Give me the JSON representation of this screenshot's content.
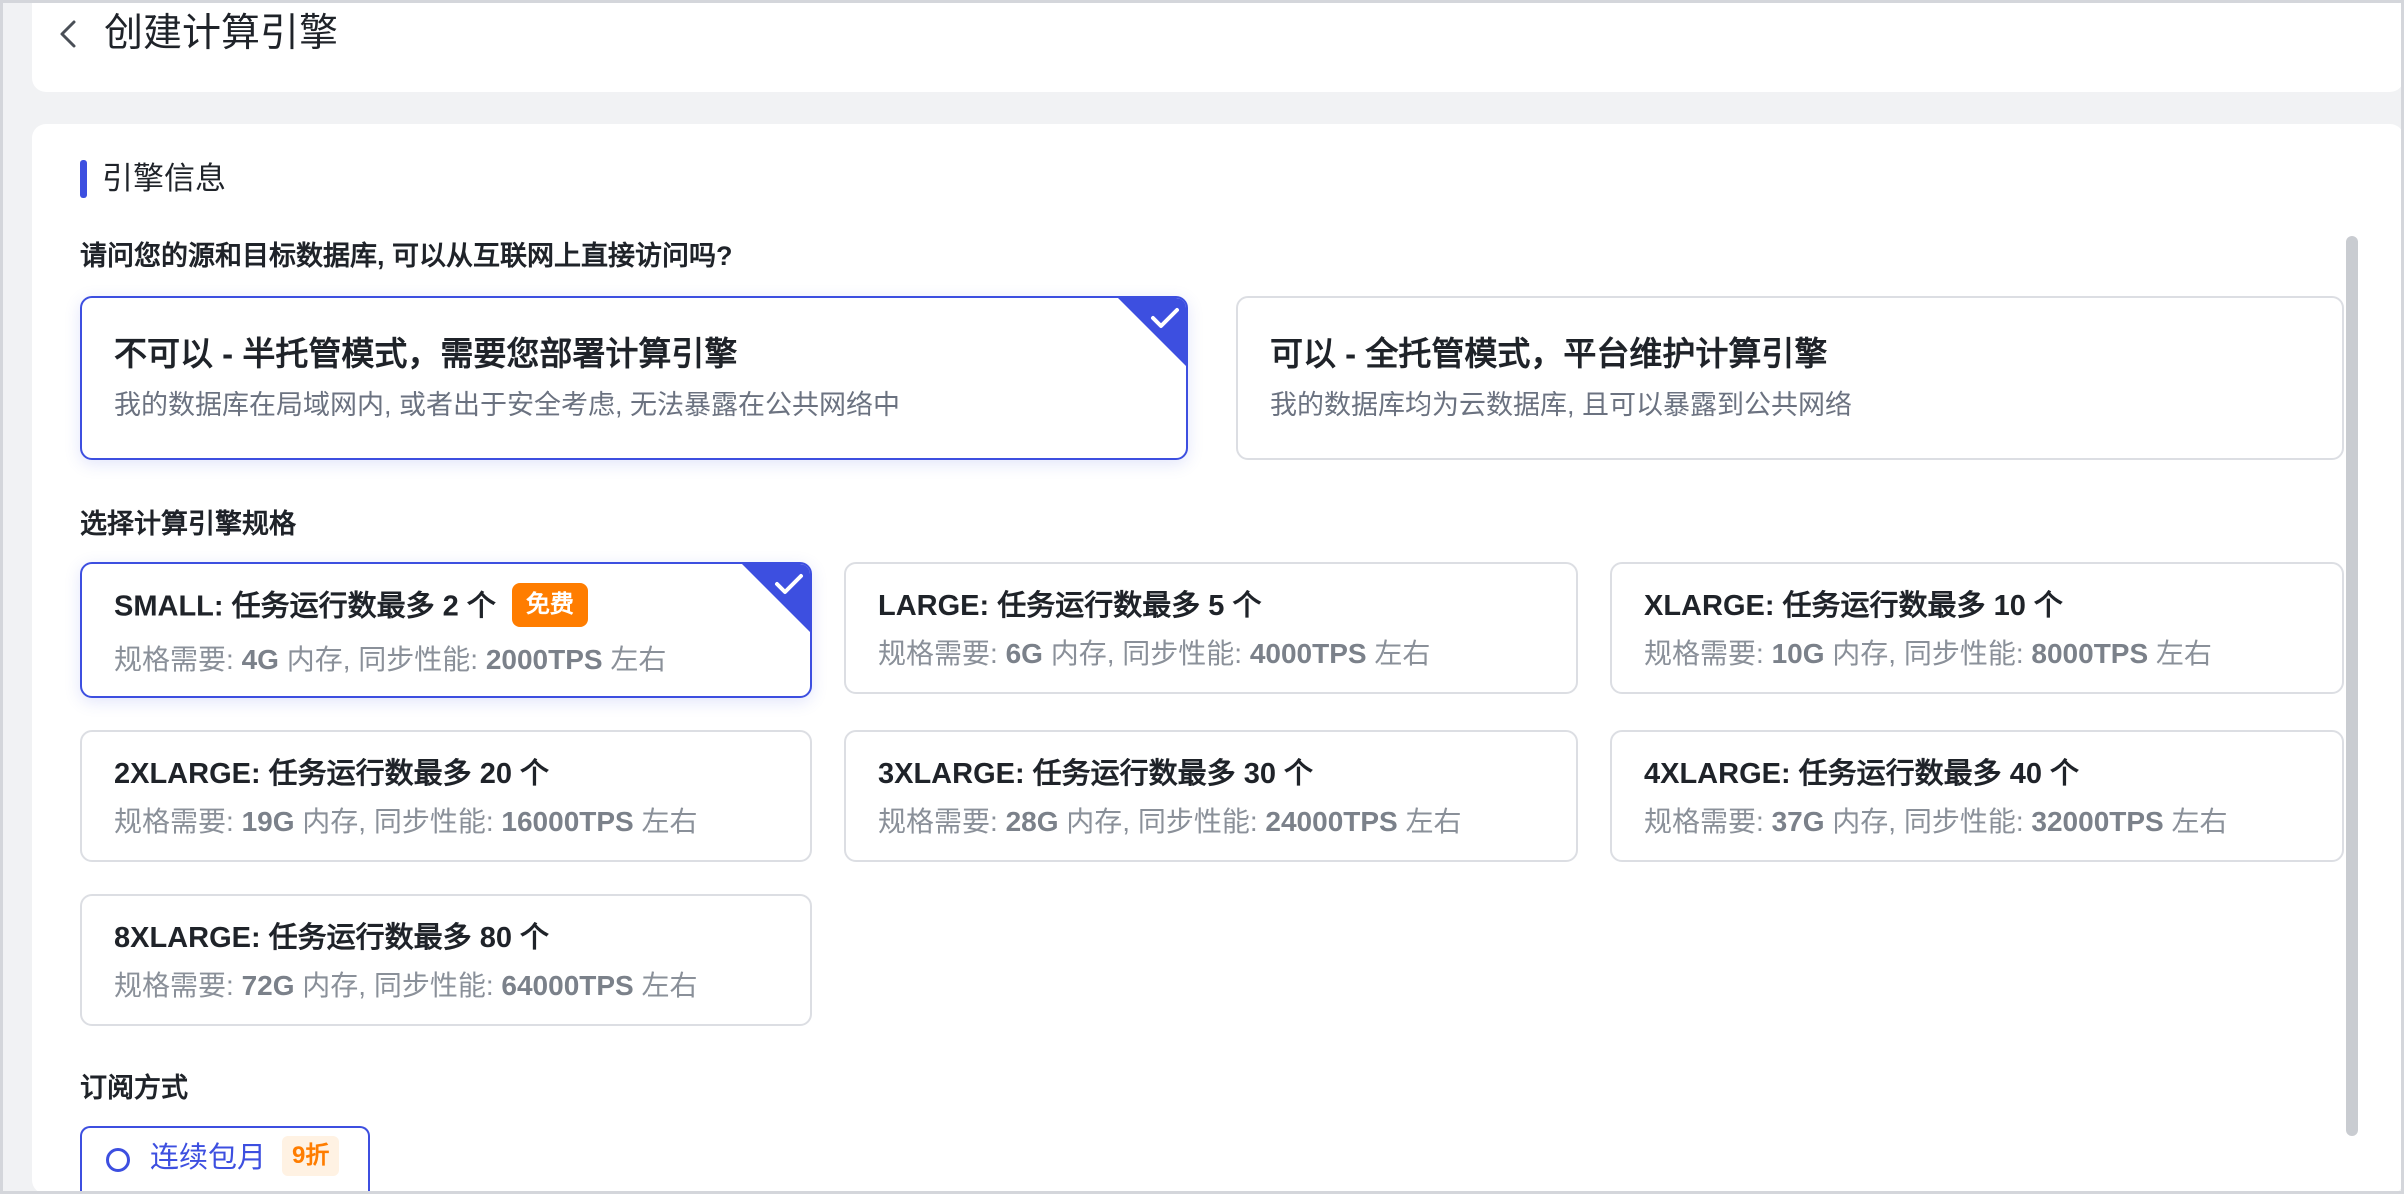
{
  "header": {
    "title": "创建计算引擎"
  },
  "section": {
    "title": "引擎信息"
  },
  "access_question": "请问您的源和目标数据库, 可以从互联网上直接访问吗?",
  "modes": [
    {
      "title": "不可以 - 半托管模式，需要您部署计算引擎",
      "desc": "我的数据库在局域网内, 或者出于安全考虑, 无法暴露在公共网络中",
      "selected": true
    },
    {
      "title": "可以 - 全托管模式，平台维护计算引擎",
      "desc": "我的数据库均为云数据库, 且可以暴露到公共网络",
      "selected": false
    }
  ],
  "spec_label": "选择计算引擎规格",
  "spec_desc_parts": {
    "prefix": "规格需要: ",
    "mem_suffix": " 内存, 同步性能: ",
    "suffix": " 左右"
  },
  "specs": [
    {
      "title": "SMALL: 任务运行数最多 2 个",
      "badge": "免费",
      "mem": "4G",
      "tps": "2000TPS",
      "selected": true
    },
    {
      "title": "LARGE: 任务运行数最多 5 个",
      "mem": "6G",
      "tps": "4000TPS"
    },
    {
      "title": "XLARGE: 任务运行数最多 10 个",
      "mem": "10G",
      "tps": "8000TPS"
    },
    {
      "title": "2XLARGE: 任务运行数最多 20 个",
      "mem": "19G",
      "tps": "16000TPS"
    },
    {
      "title": "3XLARGE: 任务运行数最多 30 个",
      "mem": "28G",
      "tps": "24000TPS"
    },
    {
      "title": "4XLARGE: 任务运行数最多 40 个",
      "mem": "37G",
      "tps": "32000TPS"
    },
    {
      "title": "8XLARGE: 任务运行数最多 80 个",
      "mem": "72G",
      "tps": "64000TPS"
    }
  ],
  "subscription": {
    "label": "订阅方式",
    "option": "连续包月",
    "discount": "9折"
  },
  "colors": {
    "accent": "#3d4fe0",
    "badge": "#ff7d00"
  }
}
